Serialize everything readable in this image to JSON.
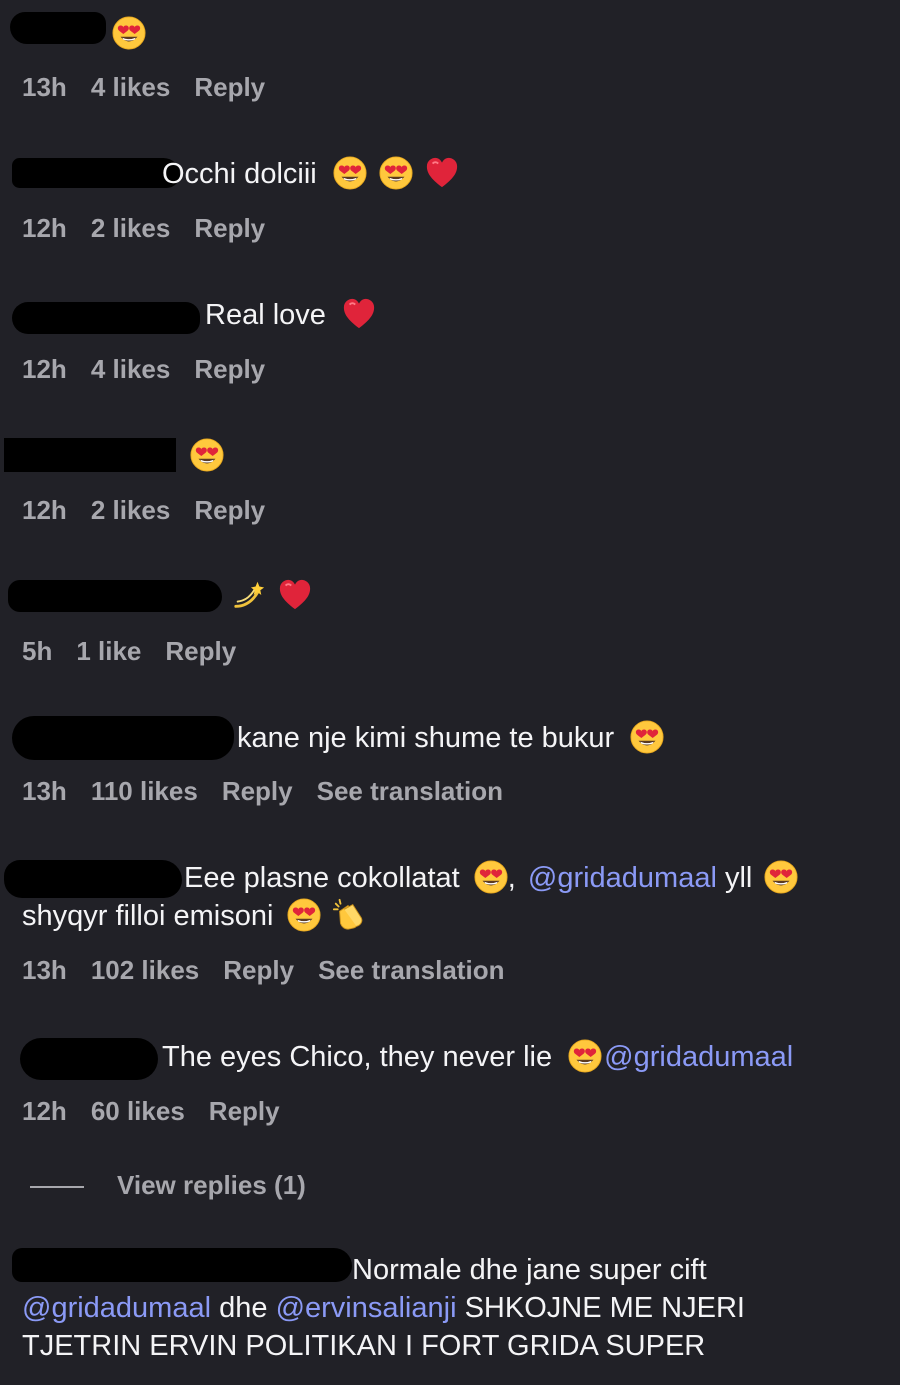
{
  "comments": [
    {
      "text": "",
      "time": "13h",
      "likes": "4 likes",
      "reply": "Reply"
    },
    {
      "text": "Occhi dolciii",
      "time": "12h",
      "likes": "2 likes",
      "reply": "Reply"
    },
    {
      "text": "Real love",
      "time": "12h",
      "likes": "4 likes",
      "reply": "Reply"
    },
    {
      "text": "",
      "time": "12h",
      "likes": "2 likes",
      "reply": "Reply"
    },
    {
      "text": "",
      "time": "5h",
      "likes": "1 like",
      "reply": "Reply"
    },
    {
      "text": "kane nje kimi shume te bukur",
      "time": "13h",
      "likes": "110 likes",
      "reply": "Reply",
      "translate": "See translation"
    },
    {
      "text_a": "Eee plasne cokollatat",
      "text_b": ",",
      "mention": "@gridadumaal",
      "text_c": "yll",
      "text_d": "shyqyr filloi emisoni",
      "time": "13h",
      "likes": "102 likes",
      "reply": "Reply",
      "translate": "See translation"
    },
    {
      "text": "The eyes Chico, they never lie",
      "mention": "@gridadumaal",
      "time": "12h",
      "likes": "60 likes",
      "reply": "Reply",
      "view_replies": "View replies (1)"
    },
    {
      "text_a": "Normale dhe jane super cift",
      "mention_a": "@gridadumaal",
      "text_b": "dhe",
      "mention_b": "@ervinsalianji",
      "text_c": "SHKOJNE ME NJERI",
      "text_d": "TJETRIN ERVIN POLITIKAN I FORT GRIDA SUPER"
    }
  ],
  "colors": {
    "background": "#212127",
    "text": "#f4f4f6",
    "meta": "#a7a7ad",
    "mention": "#8b9af6",
    "heart": "#e0243a",
    "emoji_face": "#ffc83d"
  },
  "icons": [
    "heart-eyes-icon",
    "red-heart-icon",
    "dizzy-icon",
    "clapping-hands-icon"
  ]
}
